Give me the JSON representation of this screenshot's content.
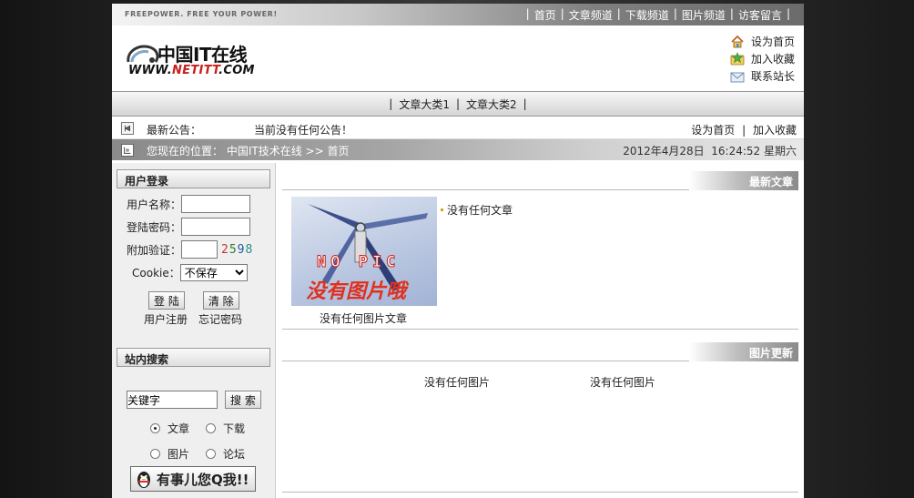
{
  "topbar": {
    "slogan": "FREEPOWER. FREE YOUR POWER!",
    "nav": [
      "首页",
      "文章频道",
      "下载频道",
      "图片频道",
      "访客留言"
    ]
  },
  "header": {
    "logo_cn": "中国IT在线",
    "logo_url_prefix": "WWW.",
    "logo_url_brand": "NETITT",
    "logo_url_suffix": ".COM",
    "quicklinks": [
      {
        "label": "设为首页",
        "icon": "home-icon"
      },
      {
        "label": "加入收藏",
        "icon": "favorite-icon"
      },
      {
        "label": "联系站长",
        "icon": "mail-icon"
      }
    ]
  },
  "categories": [
    "文章大类1",
    "文章大类2"
  ],
  "notice": {
    "label": "最新公告：",
    "text": "当前没有任何公告！",
    "links": [
      "设为首页",
      "加入收藏"
    ]
  },
  "location": {
    "prefix": "您现在的位置：",
    "site": "中国IT技术在线",
    "separator": ">>",
    "page": "首页",
    "datetime": "2012年4月28日  16:24:52 星期六"
  },
  "login": {
    "title": "用户登录",
    "username_label": "用户名称：",
    "password_label": "登陆密码：",
    "verify_label": "附加验证：",
    "captcha": [
      "2",
      "5",
      "9",
      "8"
    ],
    "cookie_label": "Cookie：",
    "cookie_value": "不保存",
    "submit": "登 陆",
    "clear": "清 除",
    "register": "用户注册",
    "forgot": "忘记密码"
  },
  "search": {
    "title": "站内搜索",
    "keyword_value": "关键字",
    "button": "搜 索",
    "options": [
      "文章",
      "下载",
      "图片",
      "论坛"
    ],
    "selected": "文章",
    "qq_badge": "有事儿您Q我!!"
  },
  "latest": {
    "title": "最新文章",
    "empty_text": "没有任何文章",
    "image_caption": "没有任何图片文章",
    "placeholder_text": "没有图片哦",
    "placeholder_tag": "NO PIC"
  },
  "pictures": {
    "title": "图片更新",
    "items": [
      "没有任何图片",
      "没有任何图片"
    ]
  },
  "colors": {
    "accent_red": "#c8201c",
    "captcha": [
      "#c0392b",
      "#2e7d32",
      "#1f5aa6",
      "#2e8b8b"
    ]
  }
}
